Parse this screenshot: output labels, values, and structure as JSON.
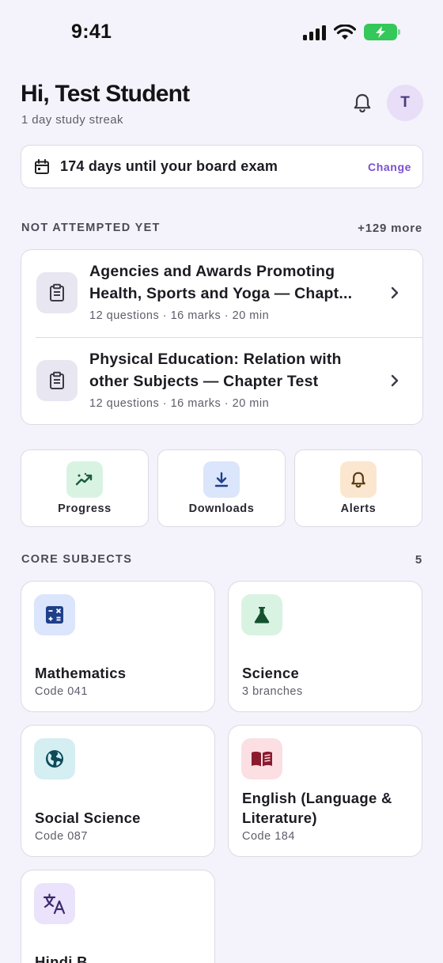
{
  "status_bar": {
    "time": "9:41"
  },
  "header": {
    "greeting": "Hi, Test Student",
    "streak": "1 day study streak",
    "avatar_initial": "T"
  },
  "exam_banner": {
    "text": "174 days until your board exam",
    "action": "Change"
  },
  "not_attempted": {
    "label": "NOT ATTEMPTED YET",
    "more": "+129 more",
    "items": [
      {
        "title": "Agencies and Awards Promoting Health, Sports and Yoga — Chapt...",
        "meta": "12 questions · 16 marks · 20 min"
      },
      {
        "title": "Physical Education: Relation with other Subjects — Chapter Test",
        "meta": "12 questions · 16 marks · 20 min"
      }
    ]
  },
  "quick_actions": [
    {
      "label": "Progress",
      "icon": "trending-up-icon",
      "bg": "#d9f3e3",
      "color": "#1f5b3a"
    },
    {
      "label": "Downloads",
      "icon": "download-icon",
      "bg": "#dbe5fb",
      "color": "#1e3f8a"
    },
    {
      "label": "Alerts",
      "icon": "bell-icon",
      "bg": "#fbe7cf",
      "color": "#5b3a12"
    }
  ],
  "core_subjects": {
    "label": "CORE SUBJECTS",
    "count": "5",
    "items": [
      {
        "name": "Mathematics",
        "sub": "Code 041",
        "icon": "calculator-icon",
        "bg": "#dbe5fb"
      },
      {
        "name": "Science",
        "sub": "3 branches",
        "icon": "flask-icon",
        "bg": "#d9f3e3"
      },
      {
        "name": "Social Science",
        "sub": "Code 087",
        "icon": "globe-icon",
        "bg": "#d4eef2"
      },
      {
        "name": "English (Language & Literature)",
        "sub": "Code 184",
        "icon": "book-icon",
        "bg": "#fbdfe3"
      },
      {
        "name": "Hindi B",
        "sub": "",
        "icon": "translate-icon",
        "bg": "#ebe2fb"
      }
    ]
  }
}
